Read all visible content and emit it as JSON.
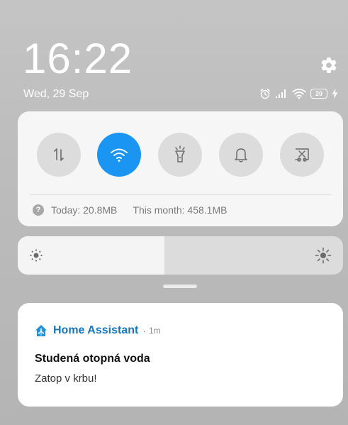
{
  "status_bar": {
    "time": "16:22",
    "date": "Wed, 29 Sep",
    "battery_level": "20",
    "icons": [
      "alarm-icon",
      "signal-icon",
      "wifi-icon",
      "battery-icon",
      "charging-icon"
    ]
  },
  "quick_settings": {
    "toggles": [
      {
        "name": "mobile-data",
        "icon": "data-transfer-icon",
        "active": false
      },
      {
        "name": "wifi",
        "icon": "wifi-icon",
        "active": true
      },
      {
        "name": "flashlight",
        "icon": "flashlight-icon",
        "active": false
      },
      {
        "name": "sound",
        "icon": "bell-icon",
        "active": false
      },
      {
        "name": "screenshot",
        "icon": "screenshot-icon",
        "active": false
      }
    ],
    "data_usage": {
      "today": "Today: 20.8MB",
      "month": "This month: 458.1MB"
    }
  },
  "brightness": {
    "level": 0.45
  },
  "notification": {
    "app_name": "Home Assistant",
    "separator": "·",
    "time": "1m",
    "title": "Studená otopná voda",
    "body": "Zatop v krbu!"
  },
  "colors": {
    "accent": "#1a95f2",
    "app_name": "#1976b8"
  }
}
